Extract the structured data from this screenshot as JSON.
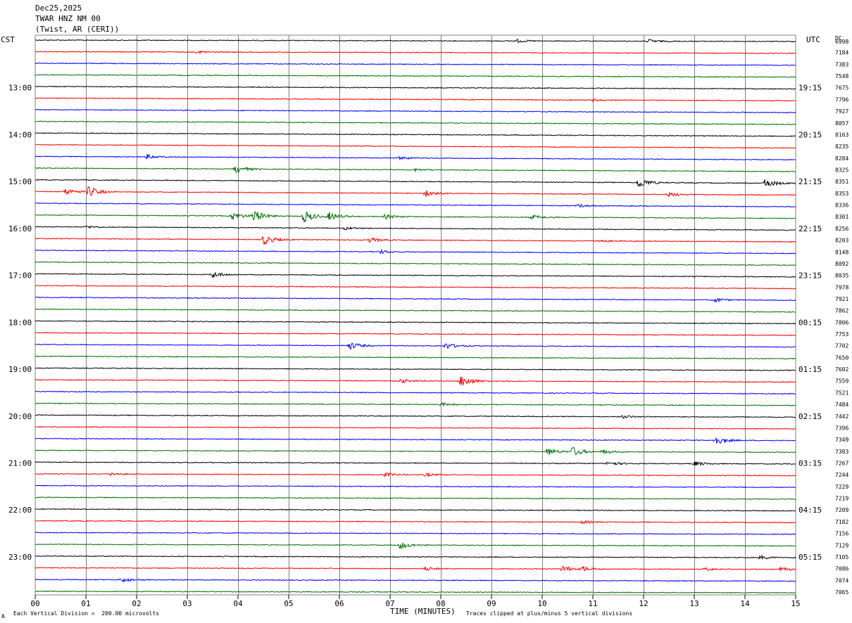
{
  "header": {
    "date": "Dec25,2025",
    "station": "TWAR HNZ NM 00",
    "location": "(Twist, AR (CERI))"
  },
  "left_axis_label": "CST",
  "right_axis_label": "UTC",
  "dc_label": "DC",
  "footer": {
    "scale_note": "Each Vertical Division =  200.00 microvolts",
    "xlabel": "TIME (MINUTES)",
    "clip_note": "Traces clipped at plus/minus 5 vertical divisions",
    "corner_mark": "A"
  },
  "colors": {
    "trace_cycle": [
      "#000000",
      "#ff0000",
      "#0000ff",
      "#007000"
    ],
    "grid": "#808080"
  },
  "chart_data": {
    "type": "line",
    "subtype": "helicorder",
    "x_ticks": [
      "00",
      "01",
      "02",
      "03",
      "04",
      "05",
      "06",
      "07",
      "08",
      "09",
      "10",
      "11",
      "12",
      "13",
      "14",
      "15"
    ],
    "xlim": [
      0,
      15
    ],
    "minutes_per_line": 15,
    "left_hour_labels": [
      "13:00",
      "14:00",
      "15:00",
      "16:00",
      "17:00",
      "18:00",
      "19:00",
      "20:00",
      "21:00",
      "22:00",
      "23:00"
    ],
    "right_hour_labels": [
      "19:15",
      "20:15",
      "21:15",
      "22:15",
      "23:15",
      "00:15",
      "01:15",
      "02:15",
      "03:15",
      "04:15",
      "05:15"
    ],
    "dc_offsets": [
      6998,
      7184,
      7383,
      7548,
      7675,
      7796,
      7927,
      8057,
      8163,
      8235,
      8284,
      8325,
      8351,
      8353,
      8336,
      8301,
      8256,
      8203,
      8148,
      8092,
      8035,
      7978,
      7921,
      7862,
      7806,
      7753,
      7702,
      7650,
      7602,
      7559,
      7521,
      7484,
      7442,
      7396,
      7349,
      7303,
      7267,
      7244,
      7229,
      7219,
      7209,
      7182,
      7156,
      7129,
      7105,
      7086,
      7074,
      7065
    ],
    "events": [
      {
        "trace": 0,
        "minute": 9.5,
        "amp": 1.0
      },
      {
        "trace": 0,
        "minute": 12.1,
        "amp": 1.2
      },
      {
        "trace": 1,
        "minute": 3.2,
        "amp": 0.8
      },
      {
        "trace": 5,
        "minute": 11.0,
        "amp": 0.7
      },
      {
        "trace": 10,
        "minute": 2.2,
        "amp": 1.5
      },
      {
        "trace": 10,
        "minute": 7.2,
        "amp": 1.0
      },
      {
        "trace": 11,
        "minute": 3.95,
        "amp": 2.5
      },
      {
        "trace": 11,
        "minute": 7.5,
        "amp": 0.8
      },
      {
        "trace": 12,
        "minute": 11.9,
        "amp": 3.5
      },
      {
        "trace": 12,
        "minute": 14.4,
        "amp": 3.0
      },
      {
        "trace": 13,
        "minute": 0.6,
        "amp": 2.0
      },
      {
        "trace": 13,
        "minute": 1.05,
        "amp": 3.5
      },
      {
        "trace": 13,
        "minute": 7.7,
        "amp": 2.5
      },
      {
        "trace": 13,
        "minute": 12.5,
        "amp": 1.5
      },
      {
        "trace": 14,
        "minute": 10.7,
        "amp": 1.0
      },
      {
        "trace": 15,
        "minute": 3.9,
        "amp": 2.5
      },
      {
        "trace": 15,
        "minute": 4.3,
        "amp": 4.0
      },
      {
        "trace": 15,
        "minute": 5.3,
        "amp": 4.0
      },
      {
        "trace": 15,
        "minute": 5.8,
        "amp": 2.5
      },
      {
        "trace": 15,
        "minute": 6.9,
        "amp": 1.5
      },
      {
        "trace": 15,
        "minute": 9.8,
        "amp": 1.5
      },
      {
        "trace": 16,
        "minute": 1.0,
        "amp": 0.8
      },
      {
        "trace": 16,
        "minute": 6.1,
        "amp": 1.0
      },
      {
        "trace": 17,
        "minute": 4.5,
        "amp": 3.5
      },
      {
        "trace": 17,
        "minute": 6.6,
        "amp": 1.5
      },
      {
        "trace": 17,
        "minute": 11.1,
        "amp": 1.0
      },
      {
        "trace": 18,
        "minute": 6.8,
        "amp": 1.2
      },
      {
        "trace": 20,
        "minute": 3.5,
        "amp": 2.0
      },
      {
        "trace": 22,
        "minute": 13.4,
        "amp": 1.5
      },
      {
        "trace": 26,
        "minute": 6.2,
        "amp": 2.5
      },
      {
        "trace": 26,
        "minute": 8.1,
        "amp": 2.0
      },
      {
        "trace": 29,
        "minute": 7.2,
        "amp": 1.5
      },
      {
        "trace": 29,
        "minute": 8.4,
        "amp": 4.0
      },
      {
        "trace": 31,
        "minute": 8.0,
        "amp": 1.0
      },
      {
        "trace": 32,
        "minute": 11.6,
        "amp": 1.0
      },
      {
        "trace": 34,
        "minute": 13.4,
        "amp": 3.0
      },
      {
        "trace": 35,
        "minute": 10.1,
        "amp": 2.5
      },
      {
        "trace": 35,
        "minute": 10.6,
        "amp": 3.0
      },
      {
        "trace": 35,
        "minute": 11.2,
        "amp": 1.5
      },
      {
        "trace": 36,
        "minute": 11.3,
        "amp": 1.5
      },
      {
        "trace": 36,
        "minute": 13.0,
        "amp": 1.5
      },
      {
        "trace": 37,
        "minute": 1.5,
        "amp": 1.0
      },
      {
        "trace": 37,
        "minute": 6.9,
        "amp": 1.2
      },
      {
        "trace": 37,
        "minute": 7.7,
        "amp": 1.0
      },
      {
        "trace": 41,
        "minute": 10.8,
        "amp": 1.0
      },
      {
        "trace": 43,
        "minute": 7.2,
        "amp": 2.5
      },
      {
        "trace": 44,
        "minute": 14.3,
        "amp": 1.2
      },
      {
        "trace": 45,
        "minute": 7.7,
        "amp": 1.2
      },
      {
        "trace": 45,
        "minute": 10.4,
        "amp": 2.0
      },
      {
        "trace": 45,
        "minute": 10.8,
        "amp": 1.2
      },
      {
        "trace": 45,
        "minute": 13.2,
        "amp": 1.0
      },
      {
        "trace": 45,
        "minute": 14.7,
        "amp": 1.2
      },
      {
        "trace": 46,
        "minute": 1.7,
        "amp": 1.5
      }
    ]
  }
}
